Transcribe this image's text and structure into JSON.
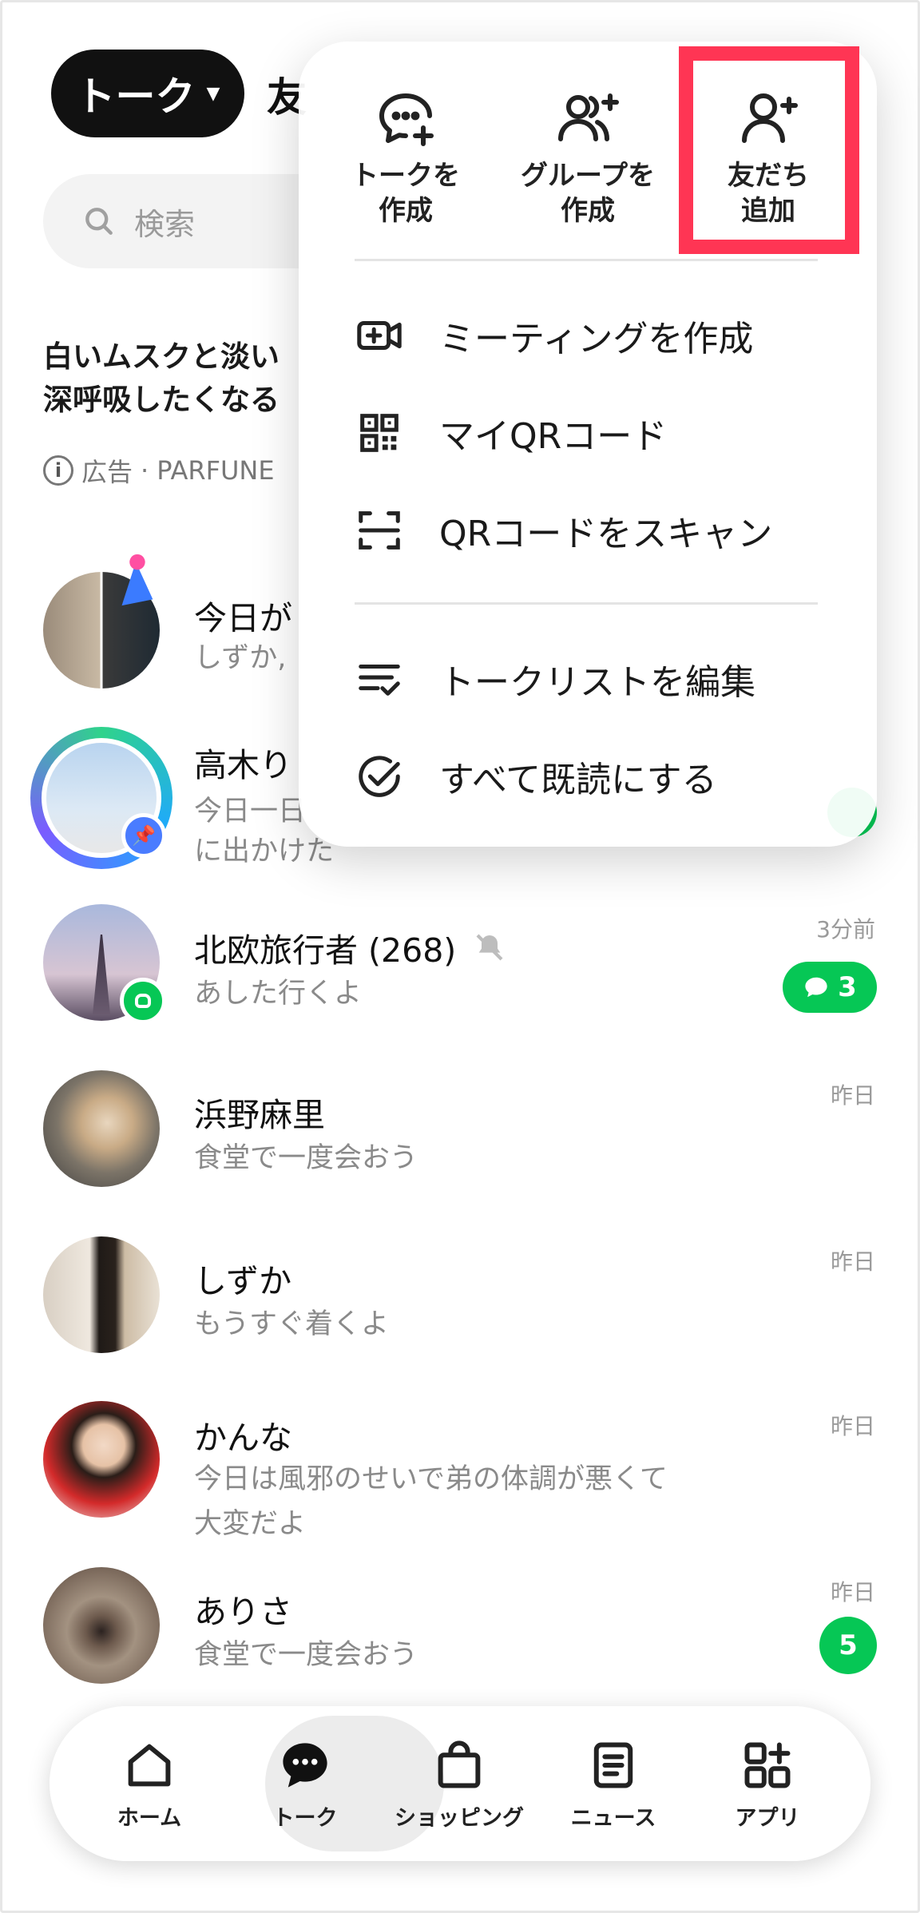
{
  "header": {
    "active_tab": "トーク",
    "next_tab": "友"
  },
  "search": {
    "placeholder": "検索"
  },
  "ad": {
    "title_line1": "白いムスクと淡い",
    "title_line2": "深呼吸したくなる",
    "label": "広告",
    "sponsor": "PARFUNE"
  },
  "chats": [
    {
      "name": "今日が",
      "preview": "しずか,",
      "time": "",
      "badge": ""
    },
    {
      "name": "高木り",
      "preview": "今日一日",
      "preview2": "に出かけた",
      "time": "",
      "badge": ""
    },
    {
      "name": "北欧旅行者 (268)",
      "preview": "あした行くよ",
      "time": "3分前",
      "badge": "3",
      "muted_icon": "mute-icon"
    },
    {
      "name": "浜野麻里",
      "preview": "食堂で一度会おう",
      "time": "昨日",
      "badge": ""
    },
    {
      "name": "しずか",
      "preview": "もうすぐ着くよ",
      "time": "昨日",
      "badge": ""
    },
    {
      "name": "かんな",
      "preview": "今日は風邪のせいで弟の体調が悪くて",
      "preview2": "大変だよ",
      "time": "昨日",
      "badge": ""
    },
    {
      "name": "ありさ",
      "preview": "食堂で一度会おう",
      "time": "昨日",
      "badge": "5"
    }
  ],
  "menu": {
    "quick_actions": [
      {
        "line1": "トークを",
        "line2": "作成",
        "icon": "chat-plus-icon"
      },
      {
        "line1": "グループを",
        "line2": "作成",
        "icon": "group-plus-icon"
      },
      {
        "line1": "友だち",
        "line2": "追加",
        "icon": "person-plus-icon"
      }
    ],
    "items": [
      {
        "label": "ミーティングを作成",
        "icon": "video-plus-icon"
      },
      {
        "label": "マイQRコード",
        "icon": "qr-code-icon"
      },
      {
        "label": "QRコードをスキャン",
        "icon": "qr-scan-icon"
      },
      {
        "label": "トークリストを編集",
        "icon": "edit-list-icon"
      },
      {
        "label": "すべて既読にする",
        "icon": "check-circle-icon"
      }
    ]
  },
  "nav": [
    {
      "label": "ホーム",
      "icon": "home-icon"
    },
    {
      "label": "トーク",
      "icon": "chat-icon"
    },
    {
      "label": "ショッピング",
      "icon": "shopping-bag-icon"
    },
    {
      "label": "ニュース",
      "icon": "news-icon"
    },
    {
      "label": "アプリ",
      "icon": "apps-icon"
    }
  ],
  "colors": {
    "brand_green": "#06c755",
    "highlight_red": "#ff3554",
    "dark": "#111111"
  }
}
